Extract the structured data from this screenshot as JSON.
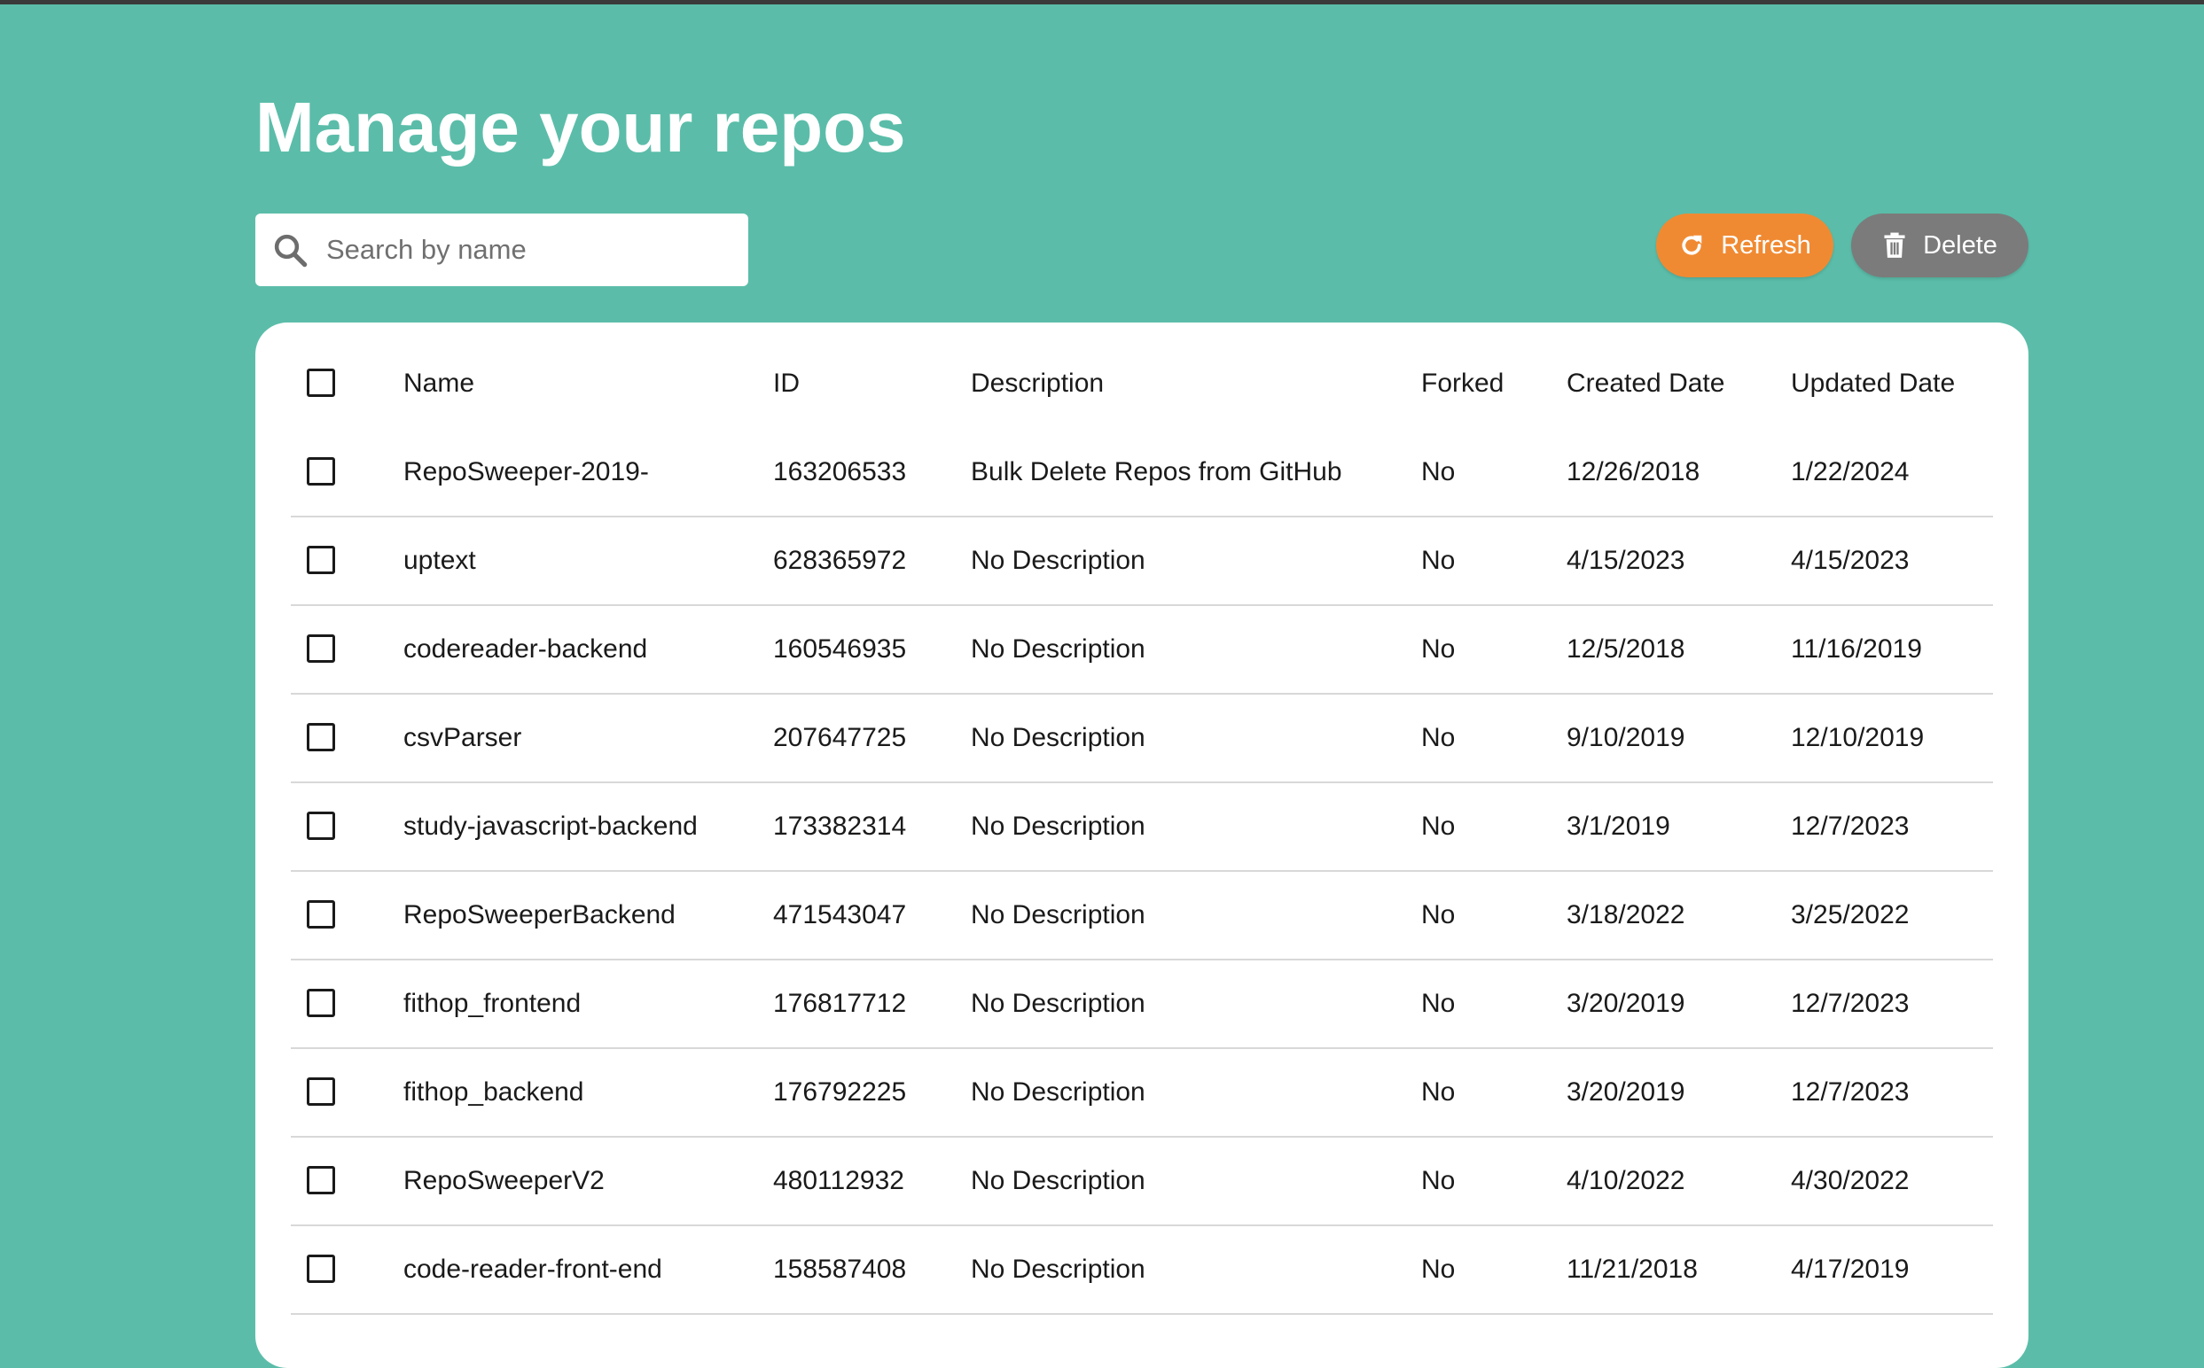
{
  "page": {
    "title": "Manage your repos"
  },
  "search": {
    "placeholder": "Search by name",
    "value": ""
  },
  "toolbar": {
    "refresh_label": "Refresh",
    "delete_label": "Delete"
  },
  "colors": {
    "background": "#5bbda9",
    "refresh": "#f08a32",
    "delete": "#7b7b7b"
  },
  "table": {
    "columns": {
      "name": "Name",
      "id": "ID",
      "description": "Description",
      "forked": "Forked",
      "created": "Created Date",
      "updated": "Updated Date"
    },
    "rows": [
      {
        "name": "RepoSweeper-2019-",
        "id": "163206533",
        "description": "Bulk Delete Repos from GitHub",
        "forked": "No",
        "created": "12/26/2018",
        "updated": "1/22/2024"
      },
      {
        "name": "uptext",
        "id": "628365972",
        "description": "No Description",
        "forked": "No",
        "created": "4/15/2023",
        "updated": "4/15/2023"
      },
      {
        "name": "codereader-backend",
        "id": "160546935",
        "description": "No Description",
        "forked": "No",
        "created": "12/5/2018",
        "updated": "11/16/2019"
      },
      {
        "name": "csvParser",
        "id": "207647725",
        "description": "No Description",
        "forked": "No",
        "created": "9/10/2019",
        "updated": "12/10/2019"
      },
      {
        "name": "study-javascript-backend",
        "id": "173382314",
        "description": "No Description",
        "forked": "No",
        "created": "3/1/2019",
        "updated": "12/7/2023"
      },
      {
        "name": "RepoSweeperBackend",
        "id": "471543047",
        "description": "No Description",
        "forked": "No",
        "created": "3/18/2022",
        "updated": "3/25/2022"
      },
      {
        "name": "fithop_frontend",
        "id": "176817712",
        "description": "No Description",
        "forked": "No",
        "created": "3/20/2019",
        "updated": "12/7/2023"
      },
      {
        "name": "fithop_backend",
        "id": "176792225",
        "description": "No Description",
        "forked": "No",
        "created": "3/20/2019",
        "updated": "12/7/2023"
      },
      {
        "name": "RepoSweeperV2",
        "id": "480112932",
        "description": "No Description",
        "forked": "No",
        "created": "4/10/2022",
        "updated": "4/30/2022"
      },
      {
        "name": "code-reader-front-end",
        "id": "158587408",
        "description": "No Description",
        "forked": "No",
        "created": "11/21/2018",
        "updated": "4/17/2019"
      }
    ]
  }
}
